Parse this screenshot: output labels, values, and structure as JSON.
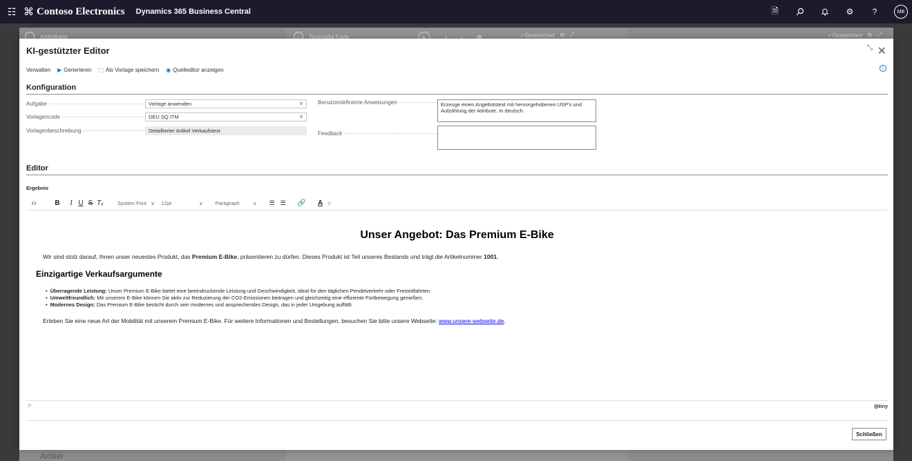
{
  "appbar": {
    "brand_logo": "⌘",
    "brand_name": "Contoso Electronics",
    "app_name": "Dynamics 365 Business Central",
    "avatar_initials": "MB"
  },
  "background": {
    "left_title": "Artikelkarte",
    "mid_title": "Textmodul Karte",
    "mid_saved": "✓Gespeichert",
    "right_saved": "✓Gespeichert",
    "left_bottom": "Artikel"
  },
  "dialog": {
    "title": "KI-gestützter Editor",
    "actions": [
      {
        "label": "Verwalten",
        "icon": ""
      },
      {
        "label": "Generieren",
        "icon": "▶"
      },
      {
        "label": "Als Vorlage speichern",
        "icon": "⬚"
      },
      {
        "label": "Quelleditor anzeigen",
        "icon": "◉"
      }
    ]
  },
  "config": {
    "heading": "Konfiguration",
    "aufgabe_label": "Aufgabe",
    "aufgabe_value": "Vorlage anwenden",
    "vorlagencode_label": "Vorlagencode",
    "vorlagencode_value": "DEU SQ ITM",
    "vorlagenbeschreibung_label": "Vorlagenbeschreibung",
    "vorlagenbeschreibung_value": "Detaillierter Artikel Verkaufstext",
    "anweisungen_label": "Benutzerdefinierte Anweisungen",
    "anweisungen_value": "Erzeuge einen Angebotstext mit hervorgehobenen USP's und Aufzählung der Attribute. In deutsch.",
    "feedback_label": "Feedback",
    "feedback_value": ""
  },
  "editor": {
    "heading": "Editor",
    "result_label": "Ergebnis",
    "font_family": "System Font",
    "font_size": "12pt",
    "block_format": "Paragraph",
    "status_path": "p",
    "tiny_brand": "tiny"
  },
  "content": {
    "title": "Unser Angebot: Das Premium E-Bike",
    "intro_pre": "Wir sind stolz darauf, Ihnen unser neuestes Produkt, das ",
    "intro_bold": "Premium E-Bike",
    "intro_mid": ", präsentieren zu dürfen. Dieses Produkt ist Teil unseres Bestands und trägt die Artikelnummer ",
    "intro_num": "1001",
    "intro_end": ".",
    "usp_heading": "Einzigartige Verkaufsargumente",
    "bullets": [
      {
        "bold": "Überragende Leistung:",
        "text": " Unser Premium E-Bike bietet eine beeindruckende Leistung und Geschwindigkeit, ideal für den täglichen Pendelverkehr oder Freizeitfahrten."
      },
      {
        "bold": "Umweltfreundlich:",
        "text": " Mit unserem E-Bike können Sie aktiv zur Reduzierung der CO2-Emissionen beitragen und gleichzeitig eine effiziente Fortbewegung genießen."
      },
      {
        "bold": "Modernes Design:",
        "text": " Das Premium E-Bike besticht durch sein modernes und ansprechendes Design, das in jeder Umgebung auffällt."
      }
    ],
    "outro_pre": "Erleben Sie eine neue Art der Mobilität mit unserem Premium E-Bike. Für weitere Informationen und Bestellungen, besuchen Sie bitte unsere Webseite: ",
    "outro_link": "www.unsere-webseite.de",
    "outro_end": "."
  },
  "footer": {
    "close_label": "Schließen"
  }
}
